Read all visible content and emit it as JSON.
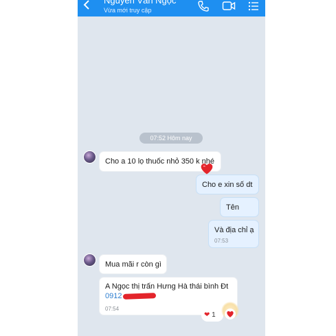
{
  "header": {
    "contact_name": "Nguyễn Văn Ngọc",
    "status": "Vừa mới truy cập",
    "color": "#1e8ff1"
  },
  "icons": {
    "back": "chevron-left-icon",
    "call": "phone-icon",
    "video": "video-camera-icon",
    "menu": "list-menu-icon",
    "reaction": "heart-icon"
  },
  "chat": {
    "date_divider": "07:52 Hôm nay",
    "messages": [
      {
        "side": "in",
        "text": "Cho a 10 lọ thuốc nhỏ 350 k nhé"
      },
      {
        "side": "out",
        "text": "Cho e xin số dt"
      },
      {
        "side": "out",
        "text": "Tên"
      },
      {
        "side": "out",
        "text": "Và địa chỉ ạ",
        "time": "07:53"
      },
      {
        "side": "in",
        "text": "Mua mãi r còn gì"
      },
      {
        "side": "in",
        "text": "A Ngọc thị trấn Hưng Hà thái bình Đt",
        "phone": "0912",
        "time": "07:54"
      }
    ],
    "reaction": {
      "emoji": "❤",
      "count": "1"
    }
  }
}
